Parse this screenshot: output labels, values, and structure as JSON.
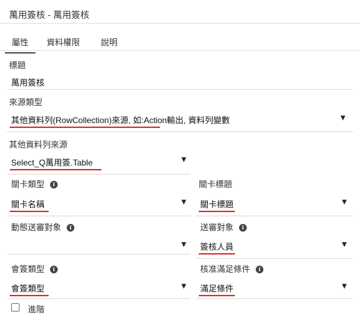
{
  "header": {
    "title": "萬用簽核 - 萬用簽核"
  },
  "tabs": [
    "屬性",
    "資料權限",
    "說明"
  ],
  "fields": {
    "title_label": "標題",
    "title_value": "萬用簽核",
    "source_type_label": "來源類型",
    "source_type_value": "其他資料列(RowCollection)來源, 如:Action輸出, 資料列變數",
    "other_source_label": "其他資料列來源",
    "other_source_value": "Select_Q萬用簽.Table",
    "checkpoint_type_label": "關卡類型",
    "checkpoint_type_value": "關卡名稱",
    "checkpoint_title_label": "關卡標題",
    "checkpoint_title_value": "關卡標題",
    "dynamic_target_label": "動態送審對象",
    "dynamic_target_value": "",
    "review_target_label": "送審對象",
    "review_target_value": "簽核人員",
    "countersign_type_label": "會簽類型",
    "countersign_type_value": "會簽類型",
    "approval_condition_label": "核准滿足條件",
    "approval_condition_value": "滿足條件"
  },
  "advanced_label": "進階",
  "icons": {
    "info": "info-icon",
    "dropdown": "caret-down-icon"
  }
}
